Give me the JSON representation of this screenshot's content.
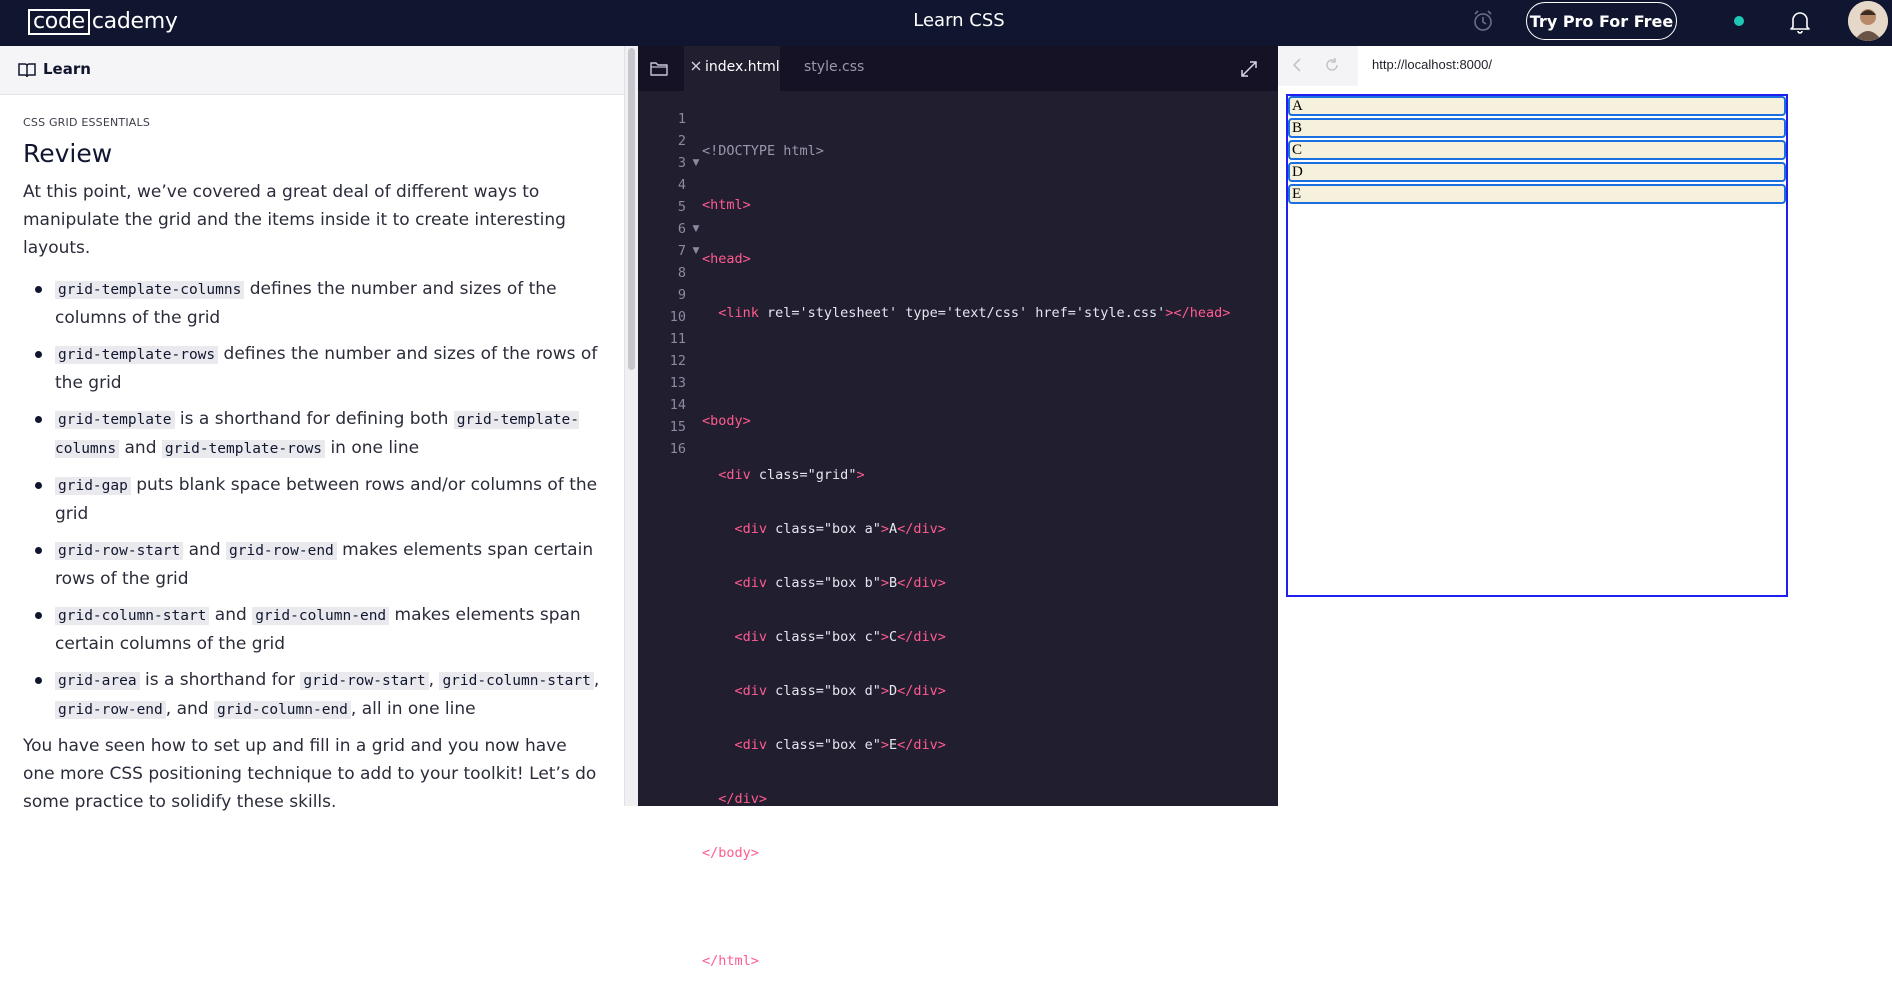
{
  "topbar": {
    "logo_boxed": "code",
    "logo_rest": "cademy",
    "title": "Learn CSS",
    "try_pro": "Try Pro For Free"
  },
  "learn": {
    "header_label": "Learn",
    "eyebrow": "CSS GRID ESSENTIALS",
    "heading": "Review",
    "intro": "At this point, we’ve covered a great deal of different ways to manipulate the grid and the items inside it to create interesting layouts.",
    "items": [
      {
        "code1": "grid-template-columns",
        "text1": " defines the number and sizes of the columns of the grid"
      },
      {
        "code1": "grid-template-rows",
        "text1": " defines the number and sizes of the rows of the grid"
      },
      {
        "code1": "grid-template",
        "text1": " is a shorthand for defining both ",
        "code2": "grid-template-columns",
        "text2": " and ",
        "code3": "grid-template-rows",
        "text3": " in one line"
      },
      {
        "code1": "grid-gap",
        "text1": " puts blank space between rows and/or columns of the grid"
      },
      {
        "code1": "grid-row-start",
        "text1": " and ",
        "code2": "grid-row-end",
        "text2": " makes elements span certain rows of the grid"
      },
      {
        "code1": "grid-column-start",
        "text1": " and ",
        "code2": "grid-column-end",
        "text2": " makes elements span certain columns of the grid"
      },
      {
        "code1": "grid-area",
        "text1": " is a shorthand for ",
        "code2": "grid-row-start",
        "text2": ", ",
        "code3": "grid-column-start",
        "text3": ", ",
        "code4": "grid-row-end",
        "text4": ", and ",
        "code5": "grid-column-end",
        "text5": ", all in one line"
      }
    ],
    "outro": "You have seen how to set up and fill in a grid and you now have one more CSS positioning technique to add to your toolkit! Let’s do some practice to solidify these skills."
  },
  "editor": {
    "tabs": {
      "active": "index.html",
      "other": "style.css"
    },
    "line_numbers": [
      "1",
      "2",
      "3",
      "4",
      "5",
      "6",
      "7",
      "8",
      "9",
      "10",
      "11",
      "12",
      "13",
      "14",
      "15",
      "16"
    ],
    "lines": [
      "<!DOCTYPE html>",
      "<html>",
      "<head>",
      "  <link rel='stylesheet' type='text/css' href='style.css'></head>",
      "",
      "<body>",
      "  <div class=\"grid\">",
      "    <div class=\"box a\">A</div>",
      "    <div class=\"box b\">B</div>",
      "    <div class=\"box c\">C</div>",
      "    <div class=\"box d\">D</div>",
      "    <div class=\"box e\">E</div>",
      "  </div>",
      "</body>",
      "",
      "</html>"
    ]
  },
  "browser": {
    "url": "http://localhost:8000/",
    "boxes": [
      "A",
      "B",
      "C",
      "D",
      "E"
    ]
  }
}
